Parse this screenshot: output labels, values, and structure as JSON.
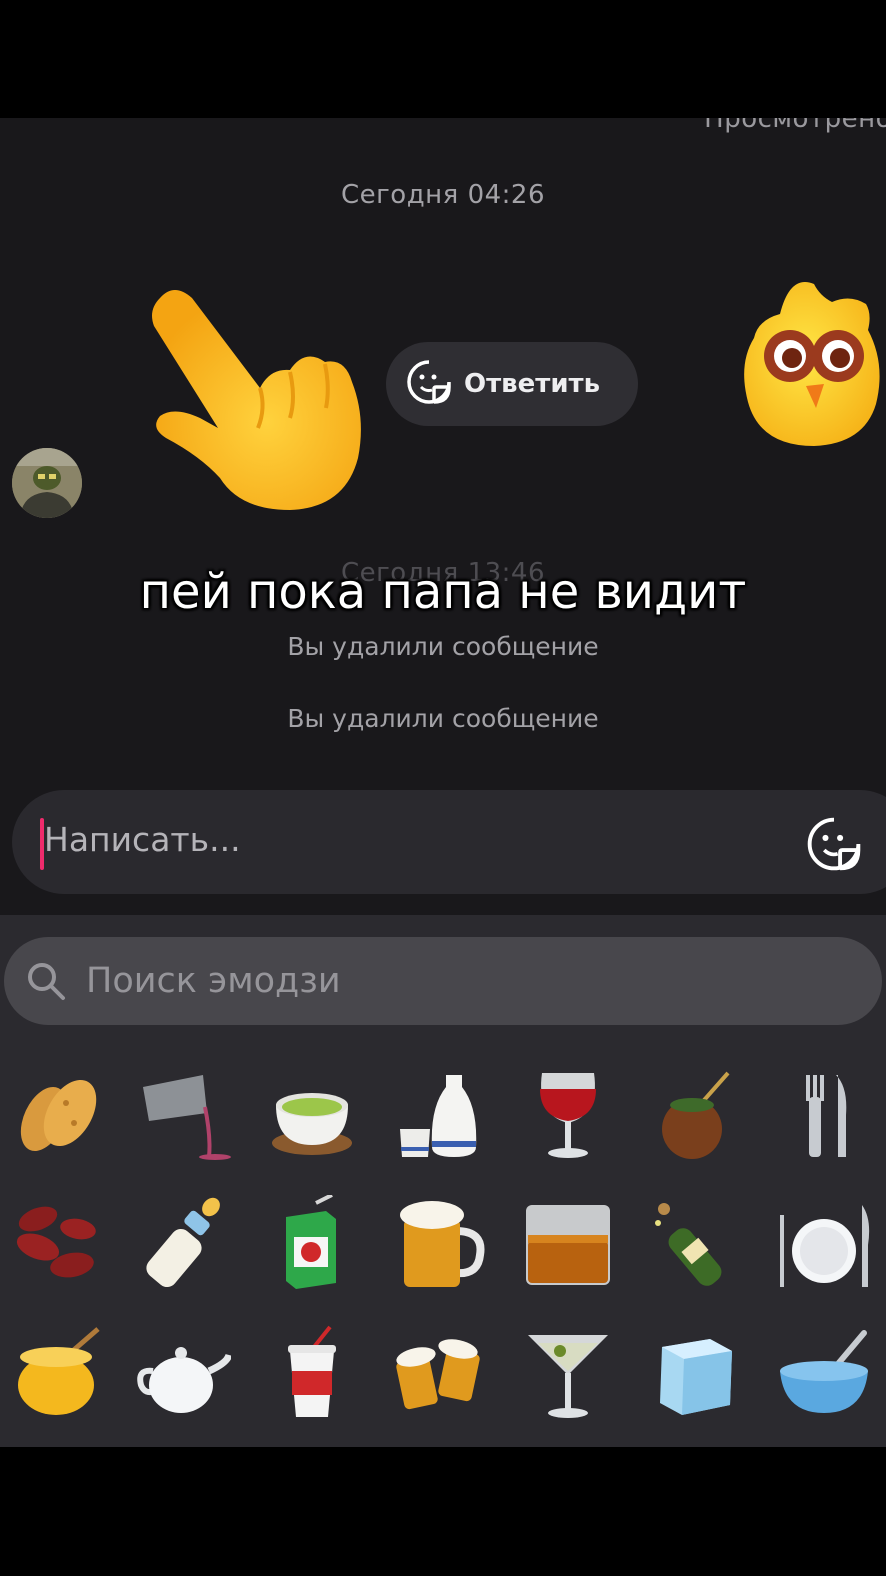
{
  "chat": {
    "top_status": "Просмотрено",
    "timestamp_1": "Сегодня 04:26",
    "timestamp_2": "Сегодня 13:46",
    "reply_label": "Ответить",
    "deleted_1": "Вы удалили сообщение",
    "deleted_2": "Вы удалили сообщение",
    "stickers": [
      "backhand-index-pointing-down",
      "yellow-chick-sticker"
    ]
  },
  "subtitle": "пей пока папа не видит",
  "composer": {
    "placeholder": "Написать...",
    "caret_color": "#ee2b6c"
  },
  "emoji_panel": {
    "search_placeholder": "Поиск эмодзи",
    "rows": [
      [
        "peanuts",
        "pouring-liquid",
        "teacup-without-handle",
        "sake",
        "wine-glass",
        "mate",
        "fork-and-knife"
      ],
      [
        "beans",
        "baby-bottle",
        "beverage-box",
        "beer-mug",
        "tumbler-glass",
        "champagne",
        "fork-knife-plate"
      ],
      [
        "honey-pot",
        "teapot",
        "cup-with-straw",
        "clinking-beer-mugs",
        "cocktail-glass",
        "ice",
        "bowl-with-spoon"
      ]
    ]
  }
}
